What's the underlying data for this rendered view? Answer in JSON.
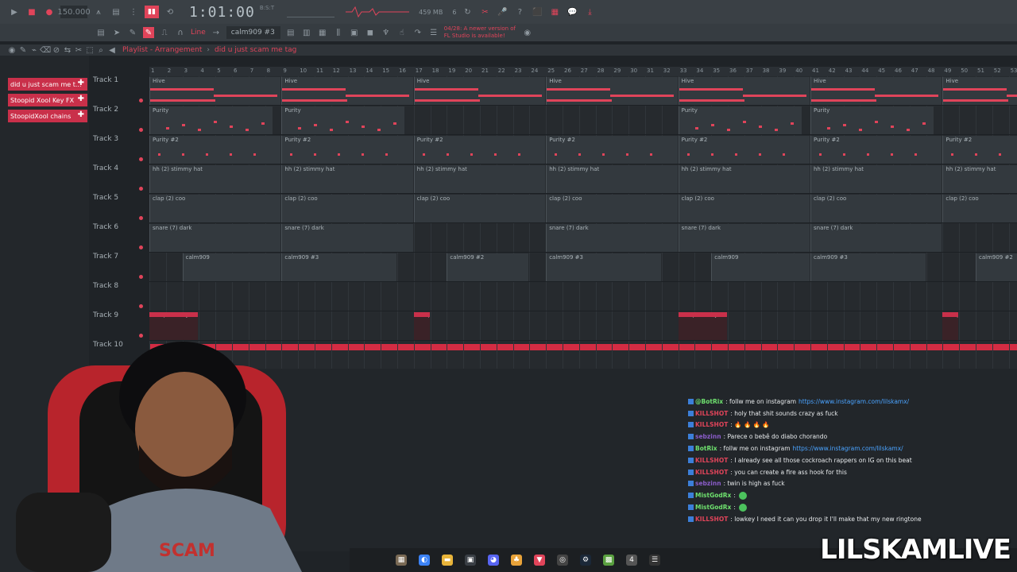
{
  "transport": {
    "tempo": "150.000",
    "clock": "1:01:00",
    "clock_sub": "B:S:T",
    "cpu": "459 MB",
    "cpu_voices": "6"
  },
  "toolbar2": {
    "snap": "Line",
    "pattern": "calm909 #3",
    "news": "04/28: A newer version of FL Studio is available!"
  },
  "playlist": {
    "crumb_root": "Playlist - Arrangement",
    "crumb_sep": "›",
    "project": "did u just scam me tag"
  },
  "picker": {
    "items": [
      "did u just scam me t...",
      "Stoopid Xool Key FX",
      "StoopidXool chains"
    ]
  },
  "tracks": [
    "Track 1",
    "Track 2",
    "Track 3",
    "Track 4",
    "Track 5",
    "Track 6",
    "Track 7",
    "Track 8",
    "Track 9",
    "Track 10"
  ],
  "ruler": [
    "1",
    "2",
    "3",
    "4",
    "5",
    "6",
    "7",
    "8",
    "9",
    "10",
    "11",
    "12",
    "13",
    "14",
    "15",
    "16",
    "17",
    "18",
    "19",
    "20",
    "21",
    "22",
    "23",
    "24",
    "25",
    "26",
    "27",
    "28",
    "29",
    "30",
    "31",
    "32",
    "33",
    "34",
    "35",
    "36",
    "37",
    "38",
    "39",
    "40",
    "41",
    "42",
    "43",
    "44",
    "45",
    "46",
    "47",
    "48",
    "49",
    "50",
    "51",
    "52",
    "53"
  ],
  "clip_labels": {
    "hive": "Hive",
    "purity": "Purity",
    "purity2": "Purity #2",
    "hh": "hh (2) stimmy hat",
    "clap": "clap (2) coo",
    "snare": "snare (7) dark",
    "calm": "calm909",
    "calm2": "calm909 #2",
    "calm3": "calm909 #3",
    "keyfx": "Stoopid..l Key FX"
  },
  "chat": [
    {
      "user": "@BotRix",
      "user_color": "#6ee06e",
      "text": ": follw me on instagram",
      "link": "https://www.instagram.com/lilskamx/"
    },
    {
      "user": "KILLSHOT",
      "user_color": "#e0445a",
      "text": ": holy that shit sounds crazy as fuck",
      "link": ""
    },
    {
      "user": "KILLSHOT",
      "user_color": "#e0445a",
      "text": ": 🔥 🔥 🔥 🔥",
      "link": ""
    },
    {
      "user": "sebzinn",
      "user_color": "#8a5cc9",
      "text": ": Parece o bebê do diabo chorando",
      "link": ""
    },
    {
      "user": "BotRix",
      "user_color": "#6ee06e",
      "text": ": follw me on instagram",
      "link": "https://www.instagram.com/lilskamx/"
    },
    {
      "user": "KILLSHOT",
      "user_color": "#e0445a",
      "text": ": I already see all those cockroach rappers on IG on this beat",
      "link": ""
    },
    {
      "user": "KILLSHOT",
      "user_color": "#e0445a",
      "text": ": you can create a fire ass hook for this",
      "link": ""
    },
    {
      "user": "sebzinn",
      "user_color": "#8a5cc9",
      "text": ": twin is high as fuck",
      "link": ""
    },
    {
      "user": "MistGodRx",
      "user_color": "#6ee06e",
      "text": ":",
      "link": ""
    },
    {
      "user": "MistGodRx",
      "user_color": "#6ee06e",
      "text": ":",
      "link": ""
    },
    {
      "user": "KILLSHOT",
      "user_color": "#e0445a",
      "text": ": lowkey I need it can you drop it I'll make that my new ringtone",
      "link": ""
    }
  ],
  "watermark": "LILSKAMLIVE",
  "colors": {
    "accent": "#e0445a",
    "grid": "#262a2e",
    "clip": "#33393e"
  }
}
